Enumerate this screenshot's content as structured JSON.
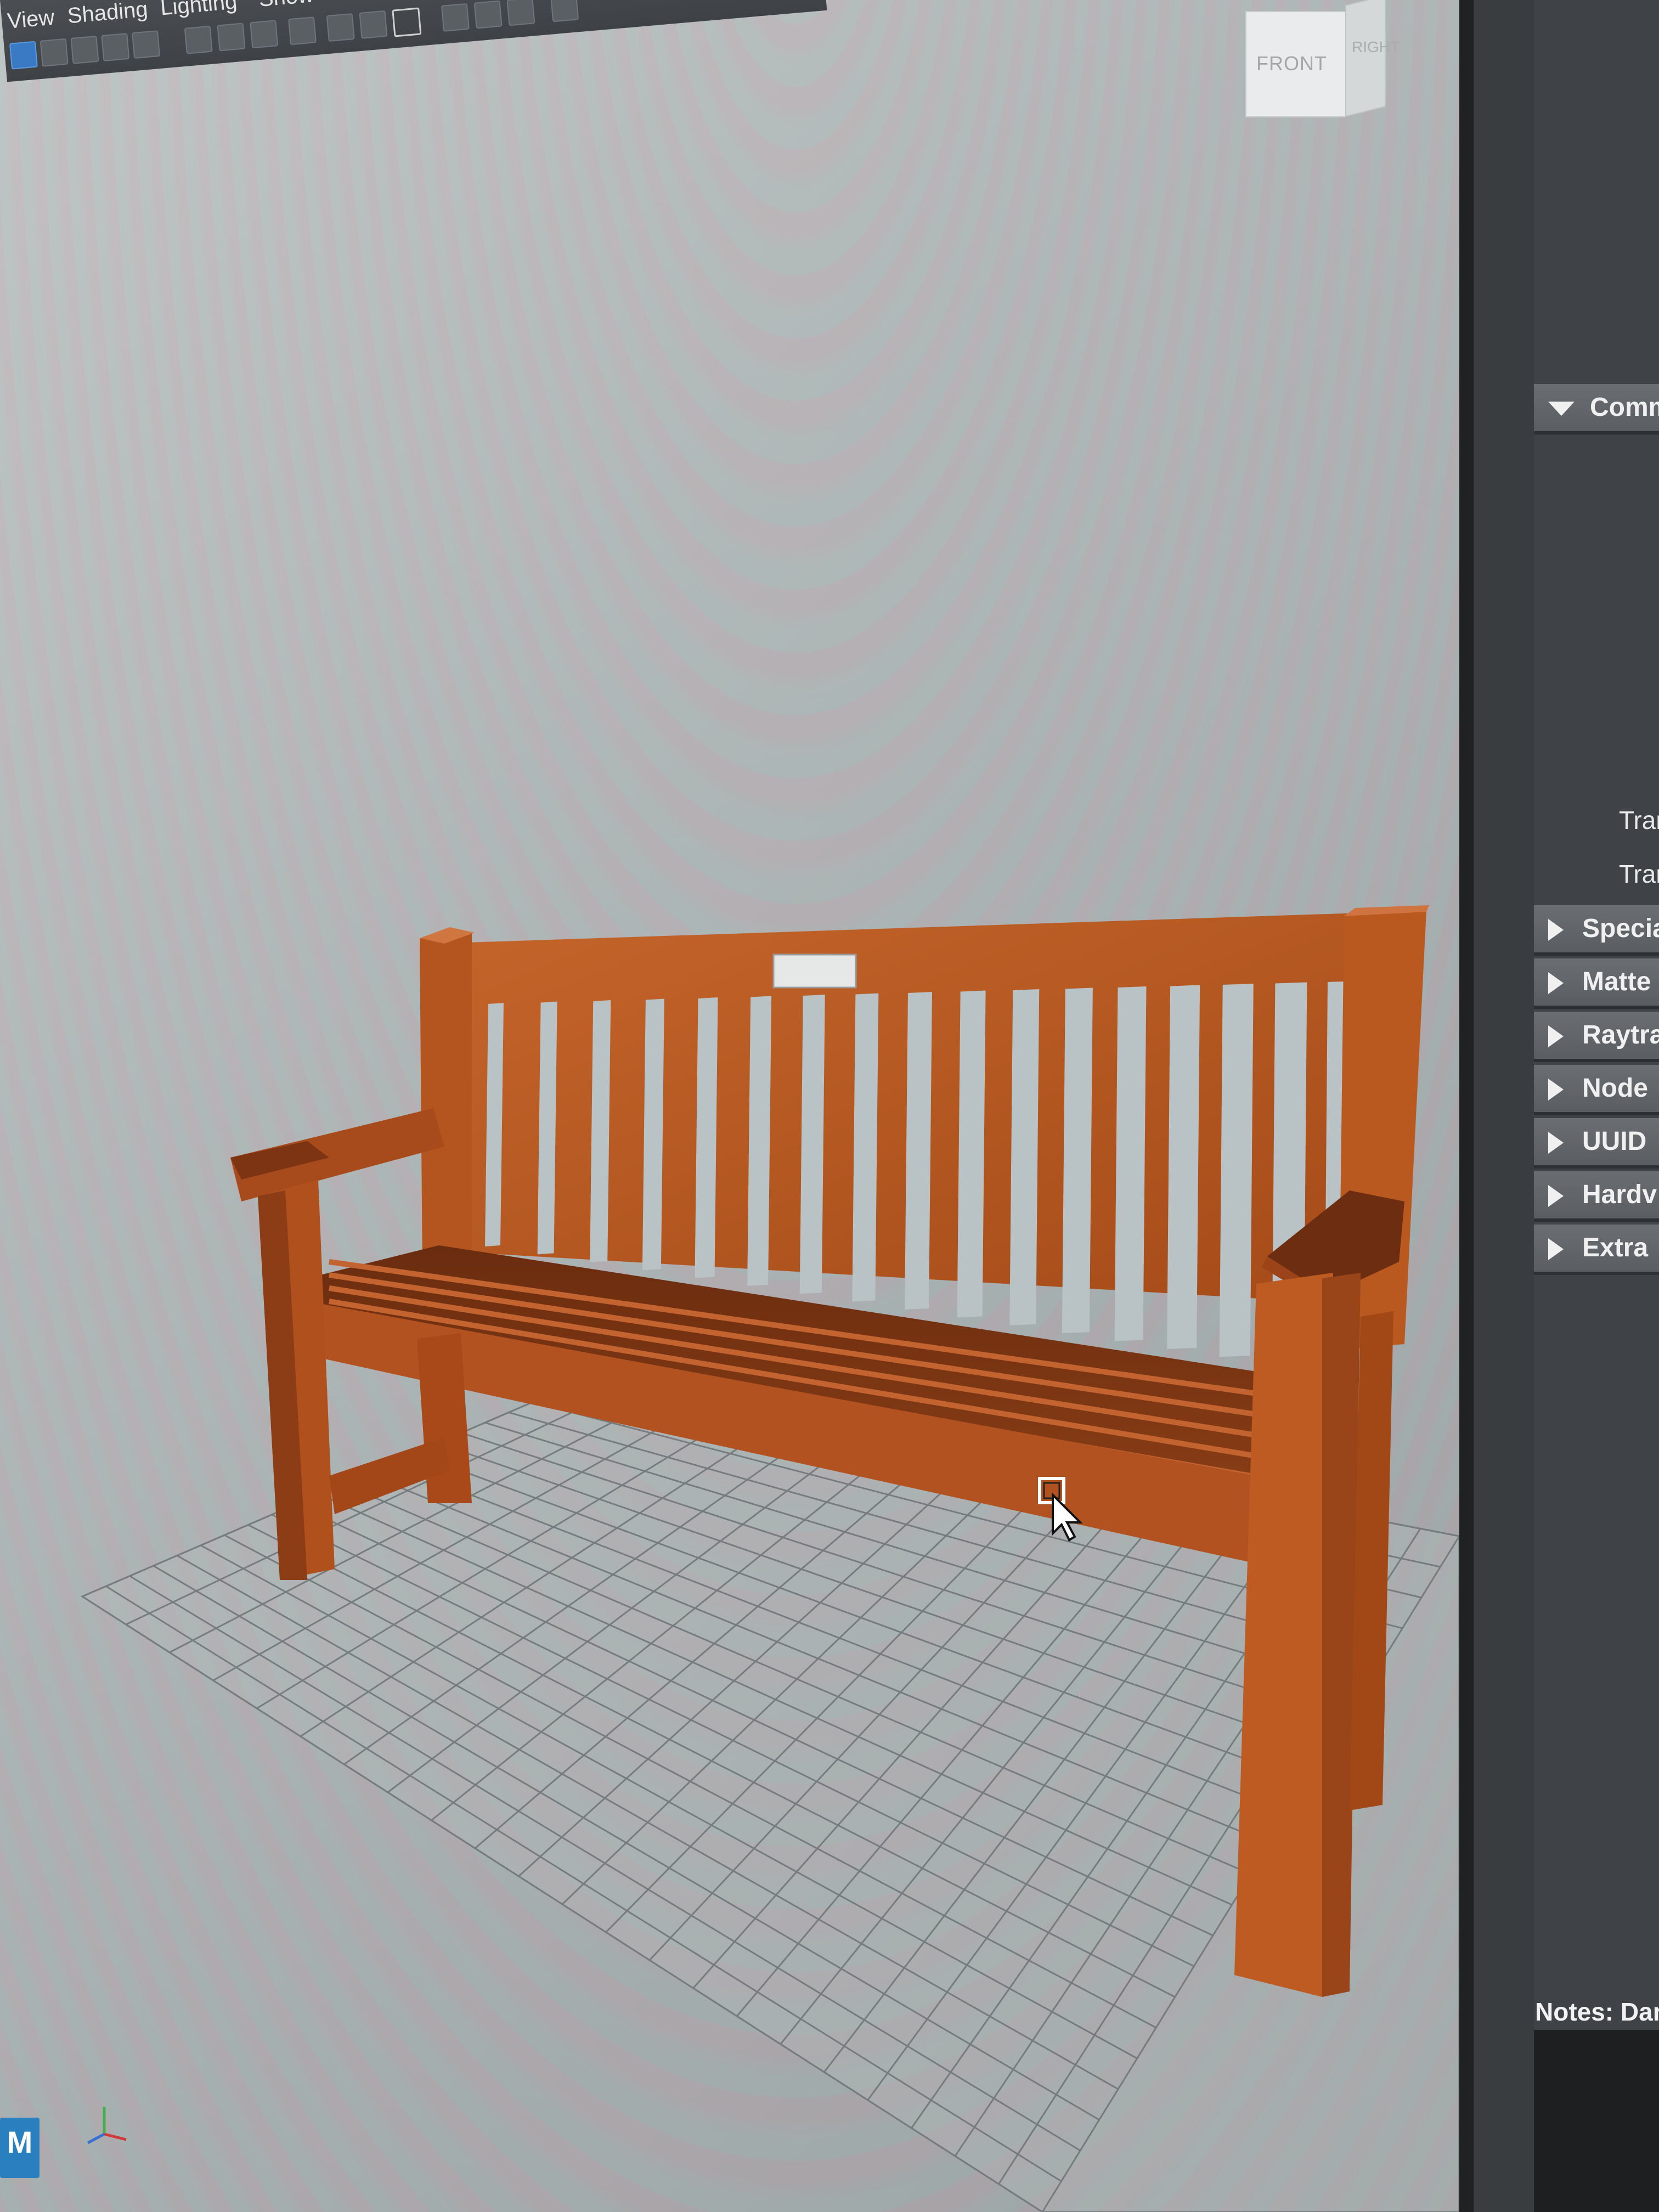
{
  "viewport": {
    "menu": [
      "View",
      "Shading",
      "Lighting",
      "Show"
    ],
    "view_cube": {
      "front_label": "FRONT",
      "right_label": "RIGHT"
    }
  },
  "attribute_editor": {
    "sections": [
      {
        "label": "Comm",
        "expanded": true
      },
      {
        "label": "Specia",
        "expanded": false
      },
      {
        "label": "Matte",
        "expanded": false
      },
      {
        "label": "Raytra",
        "expanded": false
      },
      {
        "label": "Node",
        "expanded": false
      },
      {
        "label": "UUID",
        "expanded": false
      },
      {
        "label": "Hardv",
        "expanded": false
      },
      {
        "label": "Extra",
        "expanded": false
      }
    ],
    "attributes": [
      "Trar",
      "Trar"
    ],
    "notes_label": "Notes: Dar"
  },
  "logo": {
    "label": "M"
  },
  "colors": {
    "bench_wood": "#b9581f",
    "bench_shadow": "#7a3512",
    "panel_bg": "#3a3d40",
    "section_header": "#62666a"
  },
  "icons": [
    "select-tool-icon",
    "camera-icon",
    "grid-icon",
    "cursor-icon",
    "axis-icon"
  ]
}
